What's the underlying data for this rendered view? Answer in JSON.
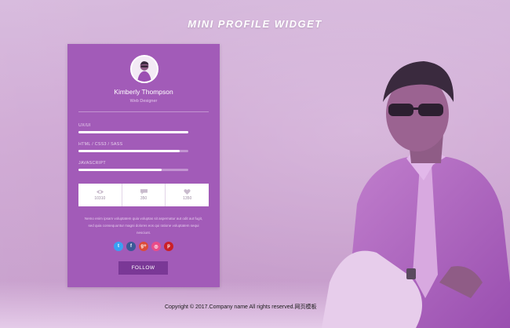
{
  "page": {
    "title": "MINI PROFILE WIDGET"
  },
  "profile": {
    "name": "Kimberly Thompson",
    "role": "Web Designer"
  },
  "skills": [
    {
      "label": "UX/UI",
      "level_percent": 100
    },
    {
      "label": "HTML / CSS3 / SASS",
      "level_percent": 92
    },
    {
      "label": "JAVASCRIPT",
      "level_percent": 76
    }
  ],
  "stats": [
    {
      "icon": "eye-icon",
      "value": "10310"
    },
    {
      "icon": "comment-icon",
      "value": "350"
    },
    {
      "icon": "heart-icon",
      "value": "1350"
    }
  ],
  "bio": "Nemo enim ipsam voluptatem quia voluptas sit aspernatur aut odit aut fugit, sed quia consequuntur magni dolores eos qui ratione voluptatem sequi nesciunt.",
  "socials": [
    {
      "name": "twitter-icon",
      "glyph": "t",
      "color": "#38a1f3"
    },
    {
      "name": "facebook-icon",
      "glyph": "f",
      "color": "#3b5998"
    },
    {
      "name": "google-plus-icon",
      "glyph": "g+",
      "color": "#dd4b39"
    },
    {
      "name": "dribbble-icon",
      "glyph": "◎",
      "color": "#ea4c89"
    },
    {
      "name": "pinterest-icon",
      "glyph": "p",
      "color": "#cb2027"
    }
  ],
  "follow_label": "FOLLOW",
  "copyright": "Copyright © 2017.Company name All rights reserved.网页模板",
  "colors": {
    "card": "#a25bb8",
    "button": "#7a3896",
    "background": "#cfa8d4"
  }
}
